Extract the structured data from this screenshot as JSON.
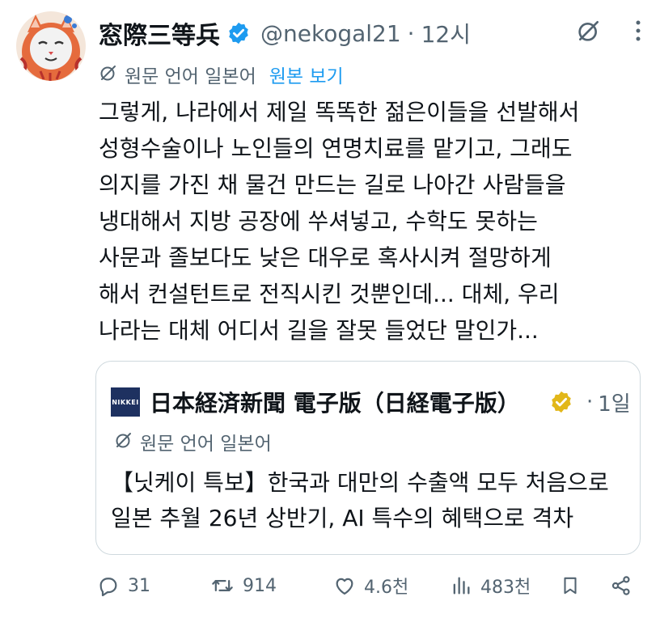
{
  "tweet": {
    "display_name": "窓際三等兵",
    "handle": "@nekogal21",
    "separator": "·",
    "time": "12시",
    "translate_label": "원문 언어 일본어",
    "translate_link": "원본 보기",
    "text_lines": [
      "그렇게, 나라에서 제일 똑똑한 젊은이들을 선발해서",
      "성형수술이나 노인들의 연명치료를 맡기고, 그래도",
      "의지를 가진 채 물건 만드는 길로 나아간 사람들을",
      "냉대해서 지방 공장에 쑤셔넣고, 수학도 못하는",
      "사문과 졸보다도 낮은 대우로 혹사시켜 절망하게",
      "해서 컨설턴트로 전직시킨 것뿐인데... 대체, 우리",
      "나라는 대체 어디서 길을 잘못 들었단 말인가..."
    ]
  },
  "quote": {
    "logo_text": "NIKKEI",
    "display_name": "日本経済新聞 電子版（日経電子版）",
    "separator": "·",
    "time": "1일",
    "translate_label": "원문 언어 일본어",
    "text_lines": [
      "【닛케이 특보】한국과 대만의 수출액 모두 처음으로",
      "일본 추월 26년 상반기, AI 특수의 혜택으로 격차"
    ]
  },
  "actions": {
    "replies": "31",
    "reposts": "914",
    "likes": "4.6천",
    "views": "483천"
  },
  "icons": {
    "verified": "verified-badge-icon",
    "grok": "grok-icon",
    "more": "more-icon",
    "translate": "translate-icon",
    "reply": "reply-icon",
    "repost": "repost-icon",
    "like": "like-icon",
    "views": "views-icon",
    "bookmark": "bookmark-icon",
    "share": "share-icon"
  },
  "colors": {
    "text": "#0f1419",
    "secondary": "#536471",
    "link": "#1d9bf0",
    "verified_blue": "#1d9bf0",
    "verified_gold": "#e2b719",
    "border": "#cfd9de",
    "nikkei_blue": "#1e3160"
  }
}
